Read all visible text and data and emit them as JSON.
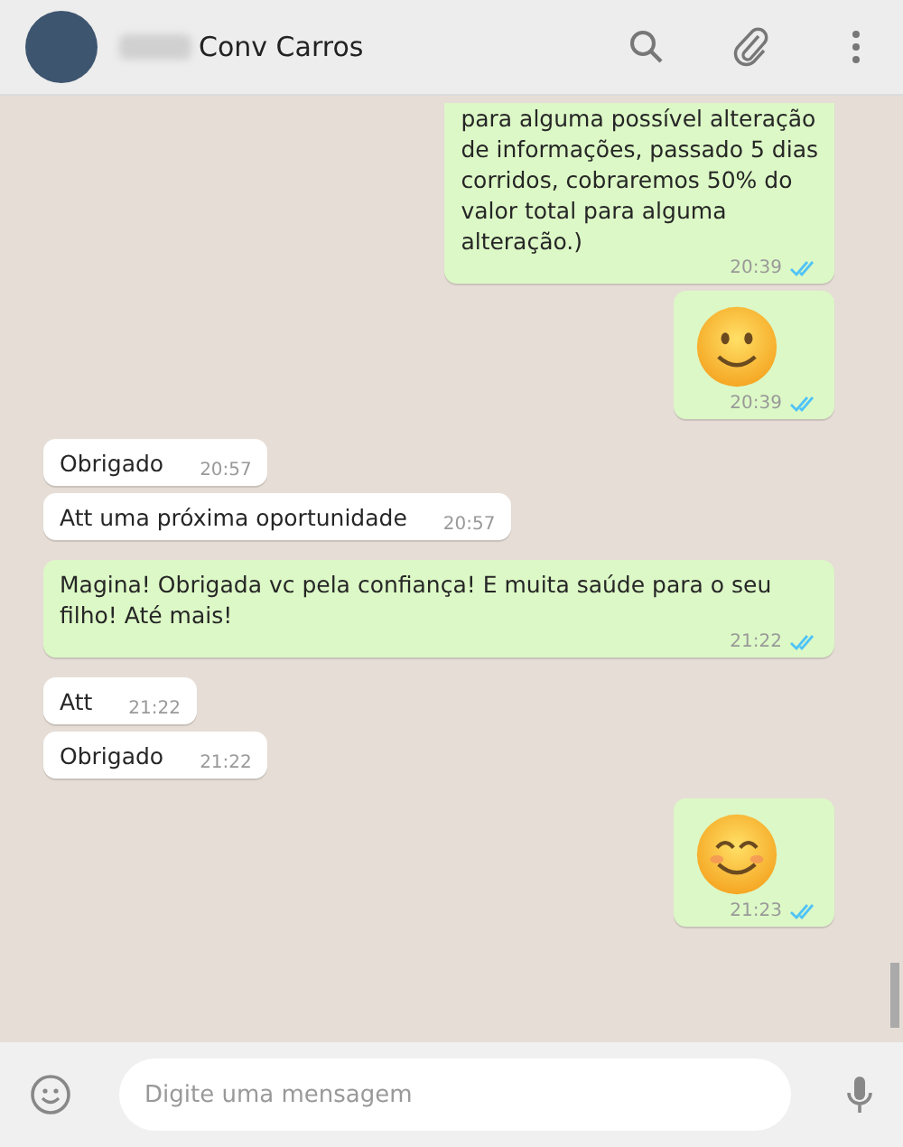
{
  "header": {
    "contact_name": "Conv Carros"
  },
  "messages": [
    {
      "kind": "text",
      "outgoing": true,
      "text": "para alguma possível alteração\nde informações, passado 5 dias\ncorridos, cobraremos 50% do\nvalor total para alguma\nalteração.)",
      "time": "20:39",
      "read": true
    },
    {
      "kind": "smile",
      "outgoing": true,
      "time": "20:39",
      "read": true
    },
    {
      "kind": "text",
      "outgoing": false,
      "text": "Obrigado",
      "time": "20:57"
    },
    {
      "kind": "text",
      "outgoing": false,
      "text": "Att uma próxima oportunidade",
      "time": "20:57"
    },
    {
      "kind": "text",
      "outgoing": true,
      "text": "Magina! Obrigada vc pela confiança! E muita saúde para o seu filho! Até mais!",
      "time": "21:22",
      "read": true
    },
    {
      "kind": "text",
      "outgoing": false,
      "text": "Att",
      "time": "21:22"
    },
    {
      "kind": "text",
      "outgoing": false,
      "text": "Obrigado",
      "time": "21:22"
    },
    {
      "kind": "blush",
      "outgoing": true,
      "time": "21:23",
      "read": true
    }
  ],
  "composer": {
    "placeholder": "Digite uma mensagem"
  }
}
